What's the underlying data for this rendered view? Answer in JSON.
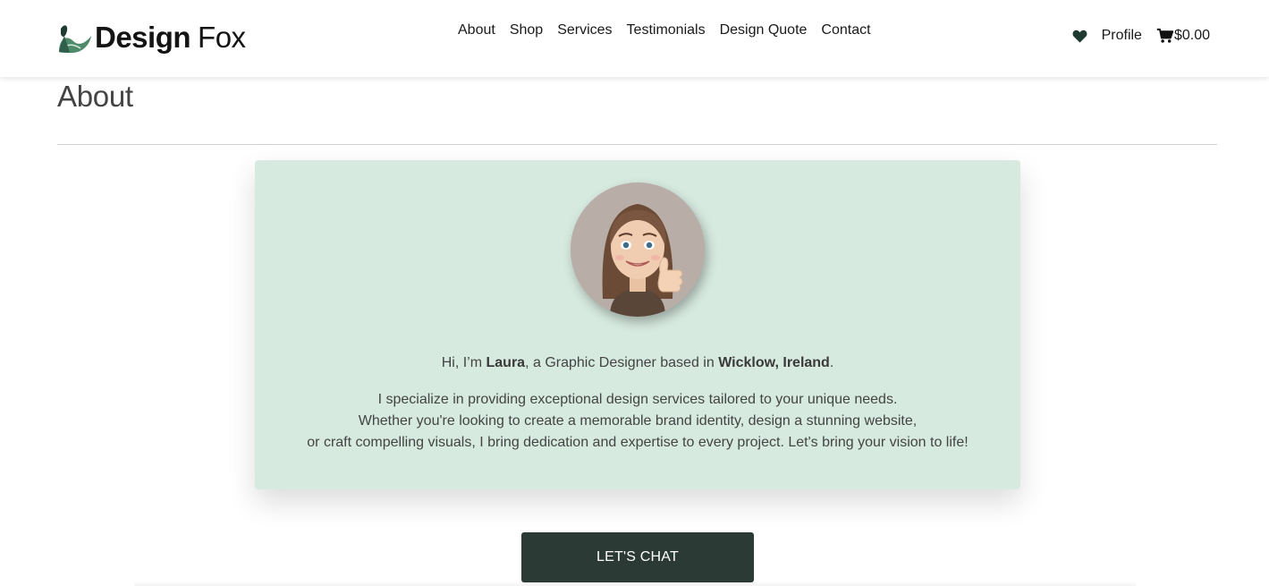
{
  "brand": {
    "bold": "Design",
    "light": "Fox"
  },
  "nav": {
    "links": [
      {
        "label": "About"
      },
      {
        "label": "Shop"
      },
      {
        "label": "Services"
      },
      {
        "label": "Testimonials"
      },
      {
        "label": "Design Quote"
      },
      {
        "label": "Contact"
      }
    ],
    "profile_label": "Profile",
    "cart_total": "$0.00"
  },
  "page": {
    "title": "About"
  },
  "about": {
    "intro_prefix": "Hi, I’m ",
    "name": "Laura",
    "intro_middle": ", a Graphic Designer based in ",
    "location": "Wicklow, Ireland",
    "intro_suffix": ".",
    "description_lines": [
      "I specialize in providing exceptional design services tailored to your unique needs.",
      "Whether you're looking to create a memorable brand identity, design a stunning website,",
      "or craft compelling visuals, I bring dedication and expertise to every project. Let's bring your vision to life!"
    ]
  },
  "cta": {
    "label": "LET'S CHAT"
  },
  "colors": {
    "card_background": "#d7eae0",
    "button_background": "#2b3a35",
    "logo_green": "#4f8a6a",
    "logo_dark": "#1f3a30",
    "avatar_background": "#b9aea7"
  },
  "icons": {
    "logo": "fox-leaf-logo-icon",
    "wishlist": "heart-icon",
    "cart": "cart-icon",
    "avatar": "memoji-avatar"
  }
}
